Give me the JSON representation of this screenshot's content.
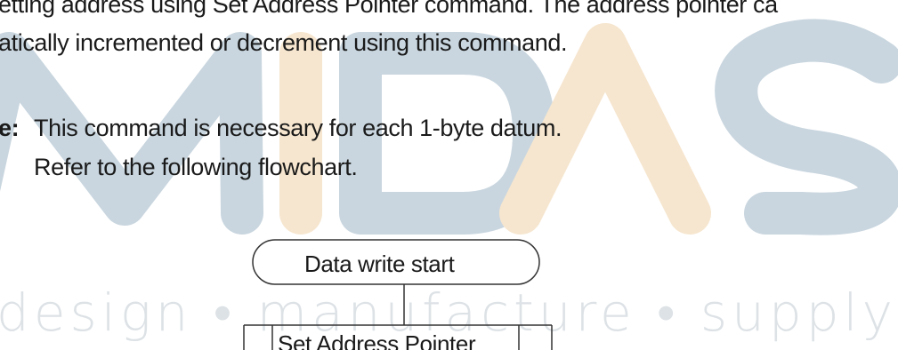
{
  "watermark": {
    "letters": "MIDAS",
    "tagline": "design • manufacture • supply",
    "colors": {
      "primary": "#c9d6df",
      "accent": "#f6e6cf",
      "tagline": "#dde2e6"
    }
  },
  "body_text": {
    "line1": "etting address using Set Address Pointer command. The address pointer ca",
    "line2": "atically incremented or decrement using this command."
  },
  "note": {
    "label": "e:",
    "line1": "This command is necessary for each 1-byte datum.",
    "line2": "Refer to the following flowchart."
  },
  "flowchart": {
    "start": "Data write start",
    "step1": "Set Address Pointer"
  }
}
